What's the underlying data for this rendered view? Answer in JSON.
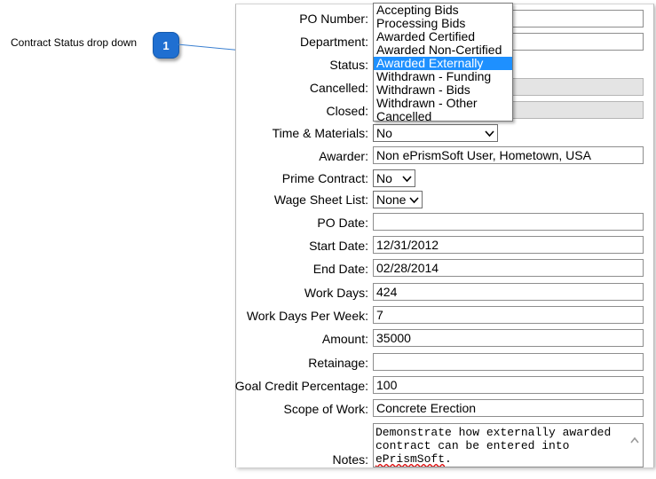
{
  "callout": {
    "label": "Contract Status drop down",
    "number": "1"
  },
  "form": {
    "po_number_label": "PO Number:",
    "department_label": "Department:",
    "status_label": "Status:",
    "cancelled_label": "Cancelled:",
    "closed_label": "Closed:",
    "tm_label": "Time & Materials:",
    "tm_value": "No",
    "awarder_label": "Awarder:",
    "awarder_value": "Non ePrismSoft User, Hometown, USA",
    "prime_label": "Prime Contract:",
    "prime_value": "No",
    "wage_label": "Wage Sheet List:",
    "wage_value": "None",
    "po_date_label": "PO Date:",
    "start_label": "Start Date:",
    "start_value": "12/31/2012",
    "end_label": "End Date:",
    "end_value": "02/28/2014",
    "work_days_label": "Work Days:",
    "work_days_value": "424",
    "wdpw_label": "Work Days Per Week:",
    "wdpw_value": "7",
    "amount_label": "Amount:",
    "amount_value": "35000",
    "retainage_label": "Retainage:",
    "goal_label": "Goal Credit Percentage:",
    "goal_value": "100",
    "scope_label": "Scope of Work:",
    "scope_value": "Concrete Erection",
    "notes_label": "Notes:",
    "notes_line1": "Demonstrate how externally awarded",
    "notes_line2": "contract can be entered into",
    "notes_line3": "ePrismSoft",
    "notes_line3_end": "."
  },
  "status_options": [
    "Accepting Bids",
    "Processing Bids",
    "Awarded Certified",
    "Awarded Non-Certified",
    "Awarded Externally",
    "Withdrawn - Funding",
    "Withdrawn - Bids",
    "Withdrawn - Other",
    "Cancelled"
  ],
  "status_selected": "Awarded Externally",
  "colors": {
    "highlight": "#1e90ff",
    "badge": "#1f6fd1",
    "leader": "#3a7fd0"
  }
}
